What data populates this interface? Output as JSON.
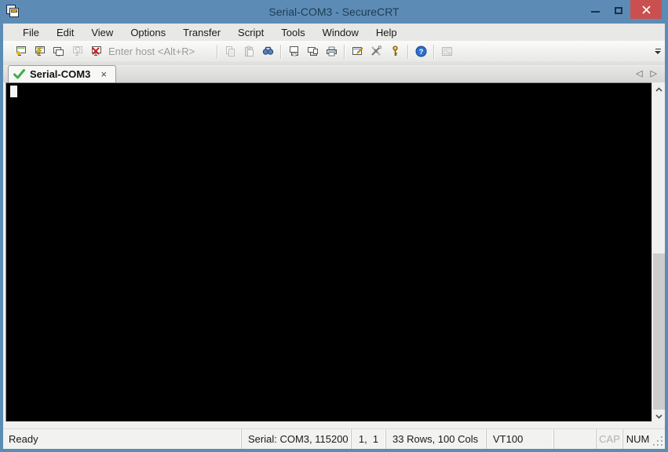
{
  "window": {
    "title": "Serial-COM3 - SecureCRT"
  },
  "menu": {
    "items": [
      "File",
      "Edit",
      "View",
      "Options",
      "Transfer",
      "Script",
      "Tools",
      "Window",
      "Help"
    ]
  },
  "toolbar": {
    "host_placeholder": "Enter host <Alt+R>",
    "icons": [
      "connect-icon",
      "quick-connect-icon",
      "connect-in-tab-icon",
      "reconnect-icon",
      "disconnect-icon",
      "copy-icon",
      "paste-icon",
      "find-icon",
      "log-session-icon",
      "raw-log-icon",
      "print-icon",
      "session-options-icon",
      "keymap-editor-icon",
      "agent-keys-icon",
      "help-icon",
      "file-transfer-icon",
      "toolbar-overflow-icon"
    ],
    "disabled_icons": [
      "reconnect-icon",
      "copy-icon",
      "paste-icon",
      "file-transfer-icon"
    ]
  },
  "tabbar": {
    "tab": {
      "label": "Serial-COM3",
      "status_icon": "connected-check-icon",
      "close_glyph": "×"
    },
    "nav": {
      "left_glyph": "◁",
      "right_glyph": "▷"
    }
  },
  "terminal": {
    "content": "",
    "cursor": "block",
    "bg_color": "#000000"
  },
  "statusbar": {
    "ready": "Ready",
    "connection": "Serial: COM3, 115200",
    "cursor_position": "1,  1",
    "terminal_size": "33 Rows, 100 Cols",
    "emulation": "VT100",
    "caps_lock": "CAP",
    "num_lock": "NUM"
  },
  "colors": {
    "titlebar": "#5C8CB5",
    "close_button": "#C9504E",
    "tab_check_green": "#3FAE49",
    "terminal_bg": "#000000",
    "statusbar_bg": "#F2F2F0"
  }
}
